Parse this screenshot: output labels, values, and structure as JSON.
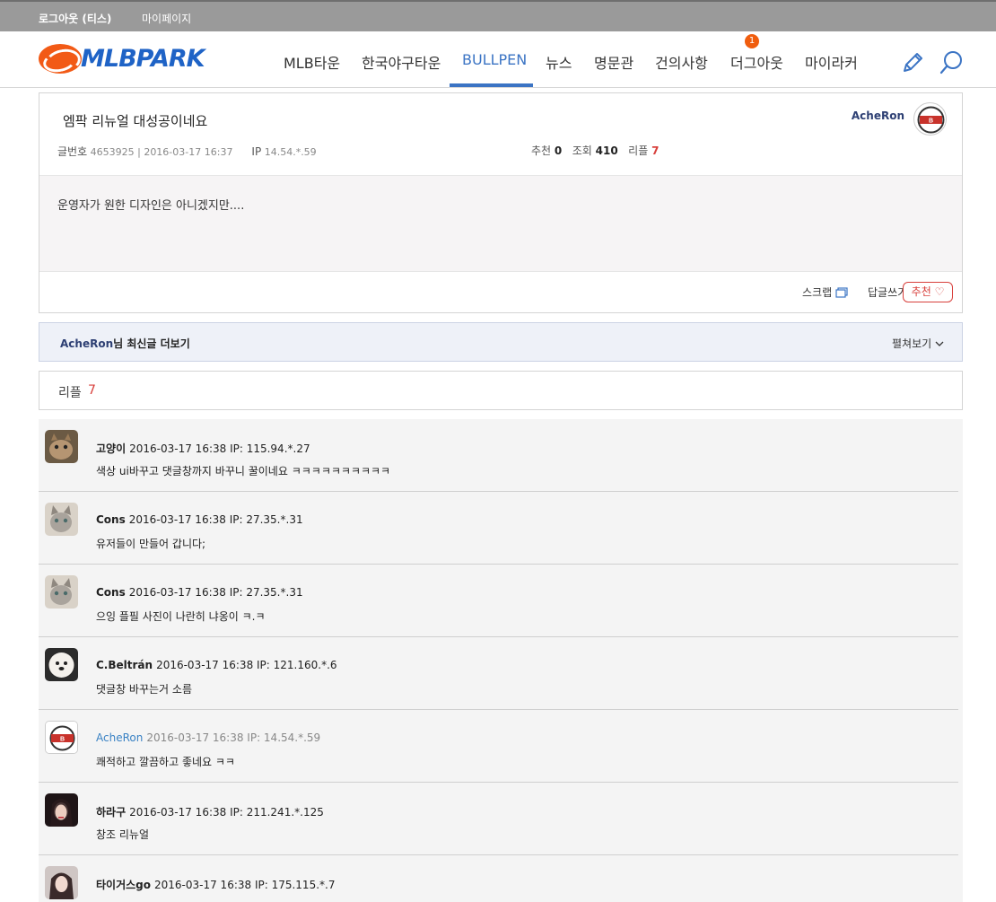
{
  "topbar": {
    "logout": "로그아웃 (티스)",
    "mypage": "마이페이지"
  },
  "header": {
    "logo_text": "MLBPARK",
    "nav": [
      "MLB타운",
      "한국야구타운",
      "BULLPEN",
      "뉴스",
      "명문관",
      "건의사항",
      "더그아웃",
      "마이라커"
    ],
    "active_nav": "BULLPEN",
    "badge": "1",
    "icons": [
      "pencil-icon",
      "search-icon"
    ],
    "accent_color": "#3b74c4",
    "logo_color": "#1f63c6"
  },
  "post": {
    "title": "엠팍 리뉴얼 대성공이네요",
    "author": "AcheRon",
    "meta_label": "글번호",
    "meta": "4653925 | 2016-03-17 16:37",
    "ip_label": "IP",
    "ip": "14.54.*.59",
    "recommend_label": "추천",
    "recommend": "0",
    "views_label": "조회",
    "views": "410",
    "replies_label": "리플",
    "replies": "7",
    "body": "운영자가 원한 디자인은 아니겠지만....",
    "actions": {
      "scrap": "스크랩",
      "reply": "답글쓰기",
      "recommend": "추천 ♡"
    }
  },
  "more": {
    "author": "AcheRon",
    "label": "님 최신글 더보기",
    "expand": "펼쳐보기"
  },
  "reply_count": {
    "label": "리플",
    "count": "7",
    "count_color": "#d8403c"
  },
  "comments": [
    {
      "name": "고양이",
      "meta": "2016-03-17 16:38 IP: 115.94.*.27",
      "text": "색상 ui바꾸고 댓글창까지 바꾸니 꿀이네요 ㅋㅋㅋㅋㅋㅋㅋㅋㅋㅋ",
      "avatar": "cat-photo",
      "own": false
    },
    {
      "name": "Cons",
      "meta": "2016-03-17 16:38 IP: 27.35.*.31",
      "text": "유저들이 만들어 갑니다;",
      "avatar": "kitten-photo",
      "own": false
    },
    {
      "name": "Cons",
      "meta": "2016-03-17 16:38 IP: 27.35.*.31",
      "text": "으잉 플필 사진이 나란히 냐옹이 ㅋ.ㅋ",
      "avatar": "kitten-photo",
      "own": false
    },
    {
      "name": "C.Beltrán",
      "meta": "2016-03-17 16:38 IP: 121.160.*.6",
      "text": "댓글창 바꾸는거 소름",
      "avatar": "dog-photo",
      "own": false
    },
    {
      "name": "AcheRon",
      "meta": "2016-03-17 16:38 IP: 14.54.*.59",
      "text": "쾌적하고 깔끔하고 좋네요 ㅋㅋ",
      "avatar": "bears-logo",
      "own": true
    },
    {
      "name": "하라구",
      "meta": "2016-03-17 16:38 IP: 211.241.*.125",
      "text": "창조 리뉴얼",
      "avatar": "person-photo",
      "own": false
    },
    {
      "name": "타이거스go",
      "meta": "2016-03-17 16:38 IP: 175.115.*.7",
      "text": "",
      "avatar": "person-photo",
      "own": false
    }
  ]
}
